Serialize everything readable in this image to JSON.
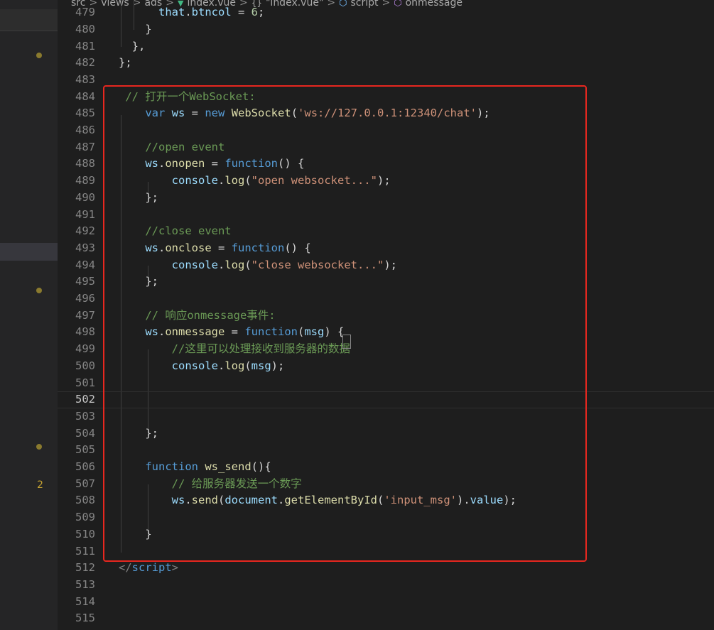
{
  "breadcrumb": {
    "items": [
      "src",
      "views",
      "ads",
      "index.vue",
      "\"index.vue\"",
      "script",
      "onmessage"
    ],
    "separator": ">",
    "icons": [
      "vue-icon",
      "braces-icon",
      "cube-icon",
      "cube-icon"
    ]
  },
  "sidebar": {
    "problem_badge": "2"
  },
  "colors": {
    "background": "#1e1e1e",
    "highlight_box": "#e8271f",
    "keyword": "#569cd6",
    "string": "#ce9178",
    "comment": "#6a9955",
    "function": "#dcdcaa",
    "variable": "#9cdcfe"
  },
  "editor": {
    "current_line": "502",
    "lines": [
      {
        "n": "479",
        "code": [
          [
            "",
            "      "
          ],
          [
            "var",
            "that"
          ],
          [
            "",
            "."
          ],
          [
            "var",
            "btncol"
          ],
          [
            "",
            " = "
          ],
          [
            "num",
            "6"
          ],
          [
            "",
            ";"
          ]
        ]
      },
      {
        "n": "480",
        "code": [
          [
            "",
            "    }"
          ]
        ]
      },
      {
        "n": "481",
        "code": [
          [
            "",
            "  },"
          ]
        ]
      },
      {
        "n": "482",
        "code": [
          [
            "",
            "};"
          ]
        ]
      },
      {
        "n": "483",
        "code": []
      },
      {
        "n": "484",
        "code": [
          [
            "",
            " "
          ],
          [
            "cmt",
            "// 打开一个WebSocket:"
          ]
        ]
      },
      {
        "n": "485",
        "code": [
          [
            "",
            "    "
          ],
          [
            "kw",
            "var"
          ],
          [
            "",
            " "
          ],
          [
            "var",
            "ws"
          ],
          [
            "",
            " = "
          ],
          [
            "kw",
            "new"
          ],
          [
            "",
            " "
          ],
          [
            "fn",
            "WebSocket"
          ],
          [
            "",
            "("
          ],
          [
            "str",
            "'ws://127.0.0.1:12340/chat'"
          ],
          [
            "",
            ");"
          ]
        ]
      },
      {
        "n": "486",
        "code": []
      },
      {
        "n": "487",
        "code": [
          [
            "",
            "    "
          ],
          [
            "cmt",
            "//open event"
          ]
        ]
      },
      {
        "n": "488",
        "code": [
          [
            "",
            "    "
          ],
          [
            "var",
            "ws"
          ],
          [
            "",
            "."
          ],
          [
            "fn",
            "onopen"
          ],
          [
            "",
            " = "
          ],
          [
            "kw",
            "function"
          ],
          [
            "",
            "() {"
          ]
        ]
      },
      {
        "n": "489",
        "code": [
          [
            "",
            "        "
          ],
          [
            "var",
            "console"
          ],
          [
            "",
            "."
          ],
          [
            "fn",
            "log"
          ],
          [
            "",
            "("
          ],
          [
            "str",
            "\"open websocket...\""
          ],
          [
            "",
            ");"
          ]
        ]
      },
      {
        "n": "490",
        "code": [
          [
            "",
            "    };"
          ]
        ]
      },
      {
        "n": "491",
        "code": []
      },
      {
        "n": "492",
        "code": [
          [
            "",
            "    "
          ],
          [
            "cmt",
            "//close event"
          ]
        ]
      },
      {
        "n": "493",
        "code": [
          [
            "",
            "    "
          ],
          [
            "var",
            "ws"
          ],
          [
            "",
            "."
          ],
          [
            "fn",
            "onclose"
          ],
          [
            "",
            " = "
          ],
          [
            "kw",
            "function"
          ],
          [
            "",
            "() {"
          ]
        ]
      },
      {
        "n": "494",
        "code": [
          [
            "",
            "        "
          ],
          [
            "var",
            "console"
          ],
          [
            "",
            "."
          ],
          [
            "fn",
            "log"
          ],
          [
            "",
            "("
          ],
          [
            "str",
            "\"close websocket...\""
          ],
          [
            "",
            ");"
          ]
        ]
      },
      {
        "n": "495",
        "code": [
          [
            "",
            "    };"
          ]
        ]
      },
      {
        "n": "496",
        "code": []
      },
      {
        "n": "497",
        "code": [
          [
            "",
            "    "
          ],
          [
            "cmt",
            "// 响应onmessage事件:"
          ]
        ]
      },
      {
        "n": "498",
        "code": [
          [
            "",
            "    "
          ],
          [
            "var",
            "ws"
          ],
          [
            "",
            "."
          ],
          [
            "fn",
            "onmessage"
          ],
          [
            "",
            " = "
          ],
          [
            "kw",
            "function"
          ],
          [
            "",
            "("
          ],
          [
            "var",
            "msg"
          ],
          [
            "",
            ") {"
          ]
        ]
      },
      {
        "n": "499",
        "code": [
          [
            "",
            "        "
          ],
          [
            "cmt",
            "//这里可以处理接收到服务器的数据"
          ]
        ]
      },
      {
        "n": "500",
        "code": [
          [
            "",
            "        "
          ],
          [
            "var",
            "console"
          ],
          [
            "",
            "."
          ],
          [
            "fn",
            "log"
          ],
          [
            "",
            "("
          ],
          [
            "var",
            "msg"
          ],
          [
            "",
            ");"
          ]
        ]
      },
      {
        "n": "501",
        "code": []
      },
      {
        "n": "502",
        "code": []
      },
      {
        "n": "503",
        "code": []
      },
      {
        "n": "504",
        "code": [
          [
            "",
            "    };"
          ]
        ]
      },
      {
        "n": "505",
        "code": []
      },
      {
        "n": "506",
        "code": [
          [
            "",
            "    "
          ],
          [
            "kw",
            "function"
          ],
          [
            "",
            " "
          ],
          [
            "fn",
            "ws_send"
          ],
          [
            "",
            "(){"
          ]
        ]
      },
      {
        "n": "507",
        "code": [
          [
            "",
            "        "
          ],
          [
            "cmt",
            "// 给服务器发送一个数字"
          ]
        ]
      },
      {
        "n": "508",
        "code": [
          [
            "",
            "        "
          ],
          [
            "var",
            "ws"
          ],
          [
            "",
            "."
          ],
          [
            "fn",
            "send"
          ],
          [
            "",
            "("
          ],
          [
            "var",
            "document"
          ],
          [
            "",
            "."
          ],
          [
            "fn",
            "getElementById"
          ],
          [
            "",
            "("
          ],
          [
            "str",
            "'input_msg'"
          ],
          [
            "",
            ")."
          ],
          [
            "var",
            "value"
          ],
          [
            "",
            ");"
          ]
        ]
      },
      {
        "n": "509",
        "code": []
      },
      {
        "n": "510",
        "code": [
          [
            "",
            "    }"
          ]
        ]
      },
      {
        "n": "511",
        "code": []
      },
      {
        "n": "512",
        "code": [
          [
            "tagb",
            "</"
          ],
          [
            "tag",
            "script"
          ],
          [
            "tagb",
            ">"
          ]
        ]
      },
      {
        "n": "513",
        "code": []
      },
      {
        "n": "514",
        "code": []
      },
      {
        "n": "515",
        "code": []
      }
    ]
  }
}
